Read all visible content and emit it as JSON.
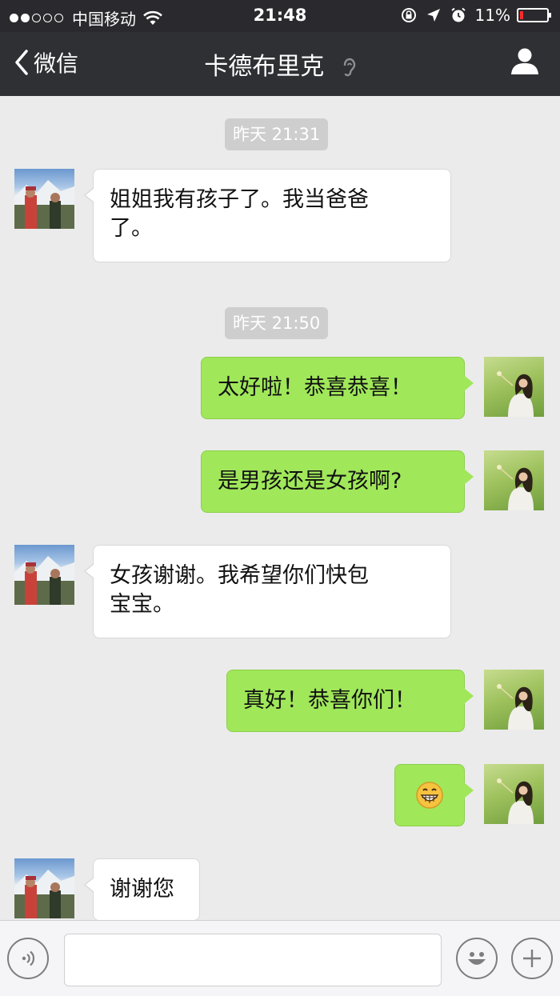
{
  "status_bar": {
    "carrier": "中国移动",
    "time": "21:48",
    "battery_percent": "11%",
    "battery_level": 0.11,
    "signal_full": 2,
    "signal_total": 5,
    "icons": [
      "wifi-icon",
      "rotation-lock-icon",
      "location-icon",
      "alarm-icon",
      "battery-icon"
    ]
  },
  "nav": {
    "back_label": "微信",
    "title": "卡德布里克",
    "icons": [
      "back-chevron-icon",
      "ear-icon",
      "profile-icon"
    ]
  },
  "chat": {
    "timestamps": [
      "昨天 21:31",
      "昨天 21:50"
    ],
    "messages": [
      {
        "from": "friend",
        "text": "姐姐我有孩子了。我当爸爸了。",
        "line1": "姐姐我有孩子了。我当爸爸",
        "line2": "了。"
      },
      {
        "from": "me",
        "text": "太好啦！恭喜恭喜！"
      },
      {
        "from": "me",
        "text": "是男孩还是女孩啊?"
      },
      {
        "from": "friend",
        "text": "女孩谢谢。我希望你们快包宝宝。",
        "line1": "女孩谢谢。我希望你们快包",
        "line2": "宝宝。"
      },
      {
        "from": "me",
        "text": "真好！恭喜你们！"
      },
      {
        "from": "me",
        "emoji": "grinning-face-emoji"
      },
      {
        "from": "friend",
        "text": "谢谢您"
      }
    ]
  },
  "input_bar": {
    "value": "",
    "icons": [
      "voice-icon",
      "emoji-smile-icon",
      "plus-icon"
    ]
  },
  "colors": {
    "nav_bg": "#2f3034",
    "chat_bg": "#ebebeb",
    "bubble_me": "#a0e75a",
    "bubble_friend": "#ffffff",
    "battery_low": "#ff2a2a"
  }
}
